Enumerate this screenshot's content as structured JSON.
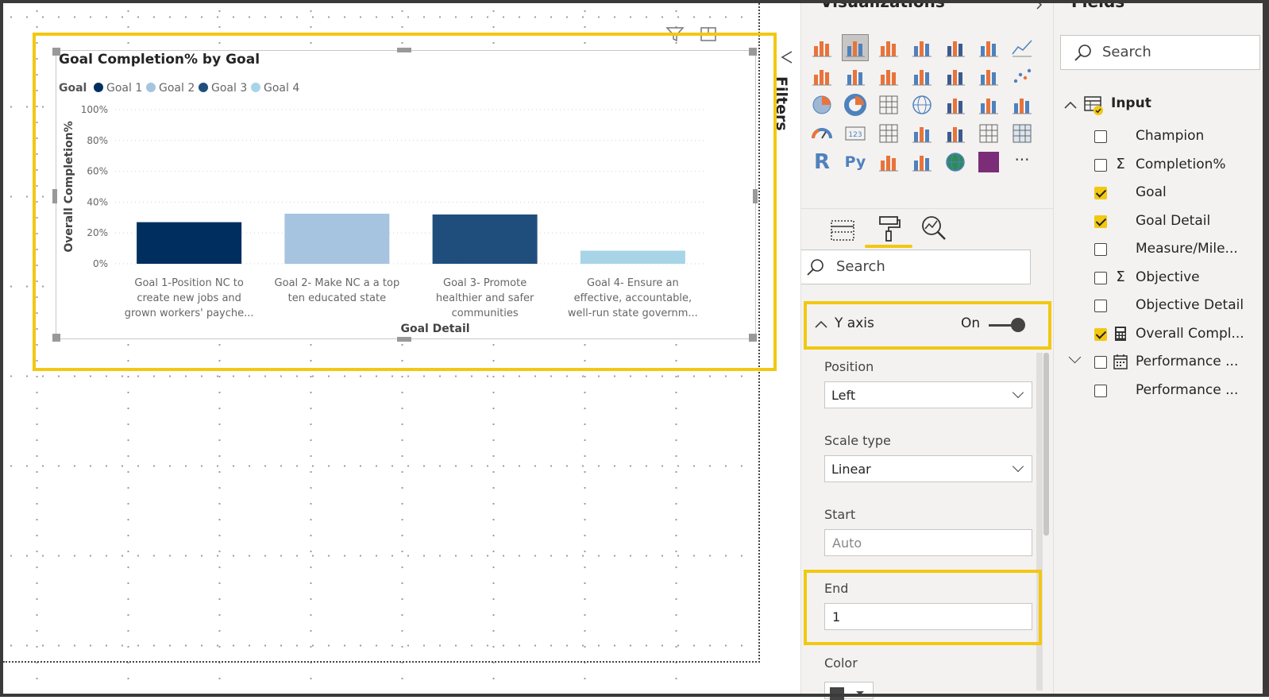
{
  "visual": {
    "chart_data": {
      "type": "bar",
      "title": "Goal Completion% by Goal",
      "legend": {
        "title": "Goal",
        "position": "top-left",
        "entries": [
          {
            "name": "Goal 1",
            "color": "#002f5f"
          },
          {
            "name": "Goal 2",
            "color": "#a6c4e0"
          },
          {
            "name": "Goal 3",
            "color": "#1f4e7d"
          },
          {
            "name": "Goal 4",
            "color": "#a8d4e8"
          }
        ]
      },
      "categories": [
        "Goal 1-Position NC to create new jobs and grown workers' payche...",
        "Goal 2- Make NC a a top ten educated state",
        "Goal 3- Promote healthier and safer communities",
        "Goal 4- Ensure an effective, accountable, well-run state governm..."
      ],
      "category_lines": [
        [
          "Goal 1-Position NC to",
          "create new jobs and",
          "grown workers' payche..."
        ],
        [
          "Goal 2- Make NC a a top",
          "ten educated state"
        ],
        [
          "Goal 3- Promote",
          "healthier and safer",
          "communities"
        ],
        [
          "Goal 4- Ensure an",
          "effective, accountable,",
          "well-run state governm..."
        ]
      ],
      "values": [
        0.27,
        0.325,
        0.32,
        0.085
      ],
      "bar_colors": [
        "#002f5f",
        "#a6c4e0",
        "#1f4e7d",
        "#a8d4e8"
      ],
      "xlabel": "Goal Detail",
      "ylabel": "Overall Completion%",
      "ylim": [
        0,
        1
      ],
      "yticks": [
        "0%",
        "20%",
        "40%",
        "60%",
        "80%",
        "100%"
      ],
      "ytick_values": [
        0,
        0.2,
        0.4,
        0.6,
        0.8,
        1.0
      ],
      "grid": true
    }
  },
  "filters": {
    "label": "Filters"
  },
  "visualizations": {
    "title": "Visualizations",
    "tabs": [
      "fields-tab",
      "format-tab",
      "analytics-tab"
    ],
    "search_placeholder": "Search",
    "card": {
      "title": "Y axis",
      "toggle_label": "On"
    },
    "position": {
      "label": "Position",
      "value": "Left"
    },
    "scale_type": {
      "label": "Scale type",
      "value": "Linear"
    },
    "start": {
      "label": "Start",
      "placeholder": "Auto"
    },
    "end": {
      "label": "End",
      "value": "1"
    },
    "color": {
      "label": "Color"
    }
  },
  "fields": {
    "title": "Fields",
    "search_placeholder": "Search",
    "table_name": "Input",
    "items": [
      {
        "name": "Champion",
        "checked": false,
        "icon": ""
      },
      {
        "name": "Completion%",
        "checked": false,
        "icon": "Σ"
      },
      {
        "name": "Goal",
        "checked": true,
        "icon": ""
      },
      {
        "name": "Goal Detail",
        "checked": true,
        "icon": ""
      },
      {
        "name": "Measure/Mile...",
        "checked": false,
        "icon": ""
      },
      {
        "name": "Objective",
        "checked": false,
        "icon": "Σ"
      },
      {
        "name": "Objective Detail",
        "checked": false,
        "icon": ""
      },
      {
        "name": "Overall Compl...",
        "checked": true,
        "icon": "calculator"
      },
      {
        "name": "Performance ...",
        "checked": false,
        "icon": "calendar"
      },
      {
        "name": "Performance ...",
        "checked": false,
        "icon": ""
      }
    ]
  },
  "colors": {
    "accent": "#f2c811"
  }
}
